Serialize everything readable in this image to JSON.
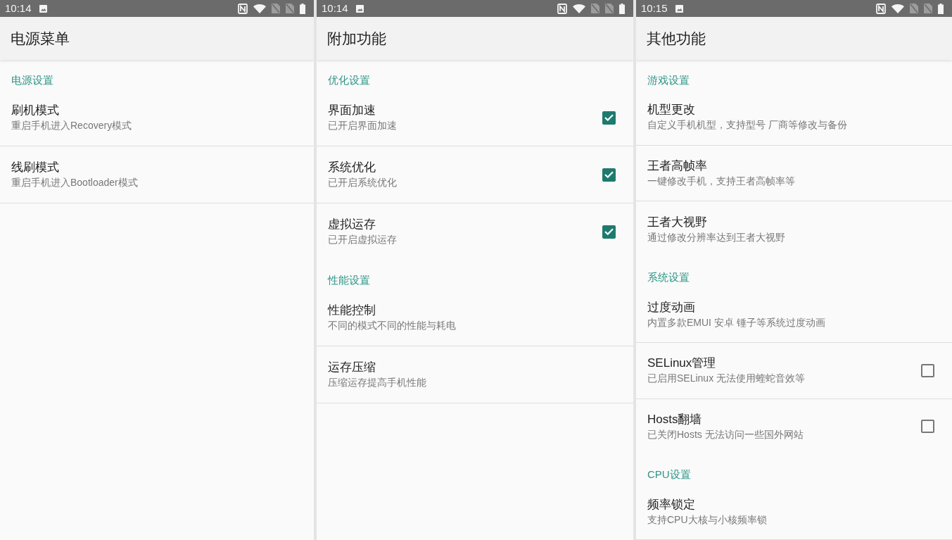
{
  "screens": [
    {
      "status_bar": {
        "time": "10:14"
      },
      "title": "电源菜单",
      "sections": [
        {
          "header": "电源设置",
          "items": [
            {
              "kind": "plain",
              "title": "刷机模式",
              "subtitle": "重启手机进入Recovery模式"
            },
            {
              "kind": "plain",
              "title": "线刷模式",
              "subtitle": "重启手机进入Bootloader模式"
            }
          ]
        }
      ]
    },
    {
      "status_bar": {
        "time": "10:14"
      },
      "title": "附加功能",
      "sections": [
        {
          "header": "优化设置",
          "items": [
            {
              "kind": "checkbox",
              "title": "界面加速",
              "subtitle": "已开启界面加速",
              "checked": true
            },
            {
              "kind": "checkbox",
              "title": "系统优化",
              "subtitle": "已开启系统优化",
              "checked": true
            },
            {
              "kind": "checkbox",
              "title": "虚拟运存",
              "subtitle": "已开启虚拟运存",
              "checked": true
            }
          ]
        },
        {
          "header": "性能设置",
          "items": [
            {
              "kind": "plain",
              "title": "性能控制",
              "subtitle": "不同的模式不同的性能与耗电"
            },
            {
              "kind": "plain",
              "title": "运存压缩",
              "subtitle": "压缩运存提高手机性能"
            }
          ]
        }
      ]
    },
    {
      "status_bar": {
        "time": "10:15"
      },
      "title": "其他功能",
      "sections": [
        {
          "header": "游戏设置",
          "items": [
            {
              "kind": "plain",
              "title": "机型更改",
              "subtitle": "自定义手机机型，支持型号 厂商等修改与备份"
            },
            {
              "kind": "plain",
              "title": "王者高帧率",
              "subtitle": "一键修改手机，支持王者高帧率等"
            },
            {
              "kind": "plain",
              "title": "王者大视野",
              "subtitle": "通过修改分辨率达到王者大视野"
            }
          ]
        },
        {
          "header": "系统设置",
          "items": [
            {
              "kind": "plain",
              "title": "过度动画",
              "subtitle": "内置多款EMUI 安卓 锤子等系统过度动画"
            },
            {
              "kind": "checkbox",
              "title": "SELinux管理",
              "subtitle": "已启用SELinux 无法使用蝰蛇音效等",
              "checked": false
            },
            {
              "kind": "checkbox",
              "title": "Hosts翻墙",
              "subtitle": "已关闭Hosts 无法访问一些国外网站",
              "checked": false
            }
          ]
        },
        {
          "header": "CPU设置",
          "items": [
            {
              "kind": "plain",
              "title": "频率锁定",
              "subtitle": "支持CPU大核与小核频率锁"
            }
          ]
        }
      ]
    }
  ]
}
